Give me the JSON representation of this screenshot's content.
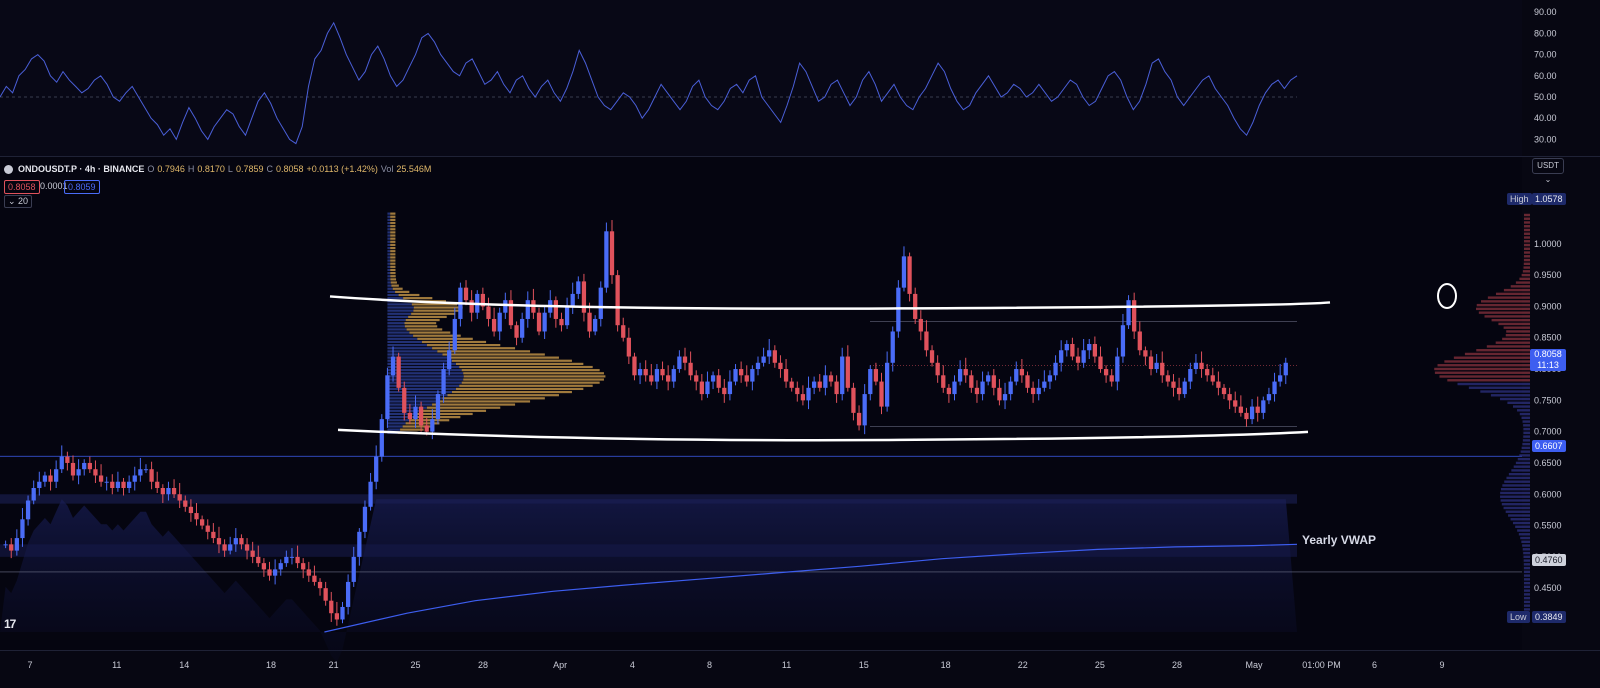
{
  "header": {
    "symbol": "ONDOUSDT.P · 4h · BINANCE",
    "o_label": "O",
    "o_value": "0.7946",
    "h_label": "H",
    "h_value": "0.8170",
    "l_label": "L",
    "l_value": "0.7859",
    "c_label": "C",
    "c_value": "0.8058",
    "change": "+0.0113 (+1.42%)",
    "vol_label": "Vol",
    "vol_value": "25.546M",
    "bid": "0.8058",
    "spread": "0.0001",
    "ask": "0.8059",
    "indicator": "20",
    "currency": "USDT"
  },
  "colors": {
    "background": "#070712",
    "bull": "#4a6cf7",
    "bear": "#e0525c",
    "profile_orange": "#d4a24c",
    "profile_blue": "#3a55c8",
    "rsi_line": "#4a5fd8",
    "vwap_line": "#3d5ef0"
  },
  "chart_data": [
    {
      "type": "line",
      "name": "RSI panel",
      "ylim": [
        25,
        92
      ],
      "y_ticks": [
        "90.00",
        "80.00",
        "70.00",
        "60.00",
        "50.00",
        "40.00",
        "30.00"
      ],
      "y_tick_values": [
        90,
        80,
        70,
        60,
        50,
        40,
        30
      ],
      "midline": 50,
      "series": [
        {
          "values": [
            50,
            55,
            52,
            60,
            63,
            68,
            70,
            67,
            60,
            57,
            62,
            58,
            55,
            52,
            54,
            58,
            60,
            56,
            50,
            48,
            52,
            55,
            50,
            45,
            40,
            37,
            32,
            35,
            30,
            38,
            45,
            40,
            34,
            30,
            36,
            40,
            44,
            42,
            36,
            32,
            40,
            48,
            52,
            47,
            40,
            35,
            30,
            28,
            36,
            55,
            68,
            72,
            80,
            85,
            78,
            70,
            64,
            58,
            62,
            70,
            74,
            68,
            60,
            55,
            58,
            64,
            70,
            78,
            80,
            76,
            70,
            66,
            62,
            60,
            66,
            68,
            62,
            56,
            58,
            62,
            56,
            52,
            58,
            60,
            54,
            50,
            55,
            58,
            52,
            48,
            54,
            62,
            72,
            66,
            58,
            50,
            46,
            44,
            48,
            52,
            50,
            46,
            40,
            44,
            50,
            56,
            52,
            48,
            44,
            48,
            55,
            58,
            50,
            46,
            44,
            48,
            54,
            56,
            52,
            58,
            60,
            50,
            46,
            42,
            38,
            46,
            55,
            66,
            62,
            55,
            48,
            50,
            56,
            58,
            52,
            46,
            50,
            58,
            62,
            56,
            48,
            52,
            56,
            50,
            46,
            44,
            50,
            54,
            60,
            66,
            62,
            54,
            48,
            44,
            46,
            52,
            56,
            60,
            55,
            50,
            52,
            56,
            54,
            50,
            52,
            56,
            52,
            48,
            50,
            54,
            58,
            56,
            50,
            46,
            48,
            54,
            60,
            62,
            58,
            50,
            44,
            48,
            56,
            66,
            68,
            62,
            58,
            50,
            46,
            50,
            54,
            58,
            60,
            54,
            50,
            46,
            40,
            35,
            32,
            38,
            46,
            52,
            56,
            58,
            54,
            58,
            60
          ]
        }
      ]
    },
    {
      "type": "candlestick",
      "name": "ONDOUSDT.P 4h",
      "ylim": [
        0.38,
        1.07
      ],
      "y_ticks": [
        "1.0000",
        "0.9500",
        "0.9000",
        "0.8500",
        "0.8000",
        "0.7500",
        "0.7000",
        "0.6500",
        "0.6000",
        "0.5500",
        "0.5000",
        "0.4500",
        "0.4000"
      ],
      "y_tick_values": [
        1.0,
        0.95,
        0.9,
        0.85,
        0.8,
        0.75,
        0.7,
        0.65,
        0.6,
        0.55,
        0.5,
        0.45,
        0.4
      ],
      "x_ticks": [
        "7",
        "11",
        "14",
        "18",
        "21",
        "25",
        "28",
        "Apr",
        "4",
        "8",
        "11",
        "15",
        "18",
        "22",
        "25",
        "28",
        "May",
        "01:00 PM",
        "6",
        "9"
      ],
      "x_tick_values": [
        0,
        18,
        32,
        50,
        63,
        80,
        94,
        110,
        125,
        141,
        157,
        173,
        190,
        206,
        222,
        238,
        254,
        268,
        279,
        293
      ],
      "price_labels": {
        "high_label": "High",
        "high_value": "1.0578",
        "current_value": "0.8058",
        "countdown": "11:13",
        "level_value": "0.6607",
        "level2_value": "0.4760",
        "low_label": "Low",
        "low_value": "0.3849"
      },
      "closes": [
        0.52,
        0.51,
        0.53,
        0.56,
        0.59,
        0.61,
        0.62,
        0.63,
        0.62,
        0.64,
        0.66,
        0.65,
        0.63,
        0.64,
        0.65,
        0.64,
        0.63,
        0.62,
        0.62,
        0.61,
        0.62,
        0.61,
        0.62,
        0.63,
        0.64,
        0.64,
        0.62,
        0.61,
        0.6,
        0.61,
        0.6,
        0.59,
        0.58,
        0.57,
        0.56,
        0.55,
        0.54,
        0.53,
        0.52,
        0.51,
        0.52,
        0.53,
        0.52,
        0.51,
        0.5,
        0.49,
        0.48,
        0.47,
        0.48,
        0.49,
        0.5,
        0.5,
        0.49,
        0.48,
        0.47,
        0.46,
        0.45,
        0.43,
        0.41,
        0.4,
        0.42,
        0.46,
        0.5,
        0.54,
        0.58,
        0.62,
        0.66,
        0.72,
        0.79,
        0.82,
        0.77,
        0.73,
        0.72,
        0.74,
        0.71,
        0.7,
        0.72,
        0.76,
        0.8,
        0.83,
        0.88,
        0.93,
        0.91,
        0.89,
        0.92,
        0.9,
        0.88,
        0.86,
        0.89,
        0.91,
        0.87,
        0.85,
        0.88,
        0.91,
        0.89,
        0.86,
        0.89,
        0.91,
        0.88,
        0.87,
        0.9,
        0.92,
        0.94,
        0.89,
        0.86,
        0.88,
        0.93,
        1.02,
        0.95,
        0.87,
        0.85,
        0.82,
        0.79,
        0.8,
        0.79,
        0.78,
        0.8,
        0.79,
        0.78,
        0.8,
        0.82,
        0.81,
        0.79,
        0.78,
        0.76,
        0.78,
        0.79,
        0.77,
        0.76,
        0.78,
        0.8,
        0.79,
        0.78,
        0.8,
        0.81,
        0.82,
        0.83,
        0.81,
        0.8,
        0.78,
        0.77,
        0.76,
        0.75,
        0.77,
        0.78,
        0.77,
        0.79,
        0.78,
        0.76,
        0.82,
        0.77,
        0.73,
        0.71,
        0.76,
        0.8,
        0.78,
        0.74,
        0.81,
        0.86,
        0.93,
        0.98,
        0.92,
        0.88,
        0.86,
        0.83,
        0.81,
        0.79,
        0.77,
        0.76,
        0.78,
        0.8,
        0.79,
        0.77,
        0.76,
        0.78,
        0.79,
        0.77,
        0.75,
        0.76,
        0.78,
        0.8,
        0.79,
        0.77,
        0.76,
        0.77,
        0.78,
        0.79,
        0.81,
        0.83,
        0.84,
        0.82,
        0.81,
        0.83,
        0.84,
        0.82,
        0.8,
        0.79,
        0.78,
        0.82,
        0.87,
        0.91,
        0.86,
        0.83,
        0.82,
        0.8,
        0.81,
        0.79,
        0.78,
        0.77,
        0.76,
        0.78,
        0.8,
        0.81,
        0.8,
        0.79,
        0.78,
        0.77,
        0.76,
        0.75,
        0.74,
        0.73,
        0.72,
        0.74,
        0.73,
        0.75,
        0.76,
        0.78,
        0.79,
        0.81
      ],
      "yearly_vwap": {
        "label": "Yearly VWAP",
        "x": [
          63,
          80,
          94,
          110,
          125,
          141,
          157,
          173,
          190,
          206,
          222,
          238,
          254,
          268
        ],
        "values": [
          0.38,
          0.41,
          0.43,
          0.445,
          0.455,
          0.465,
          0.475,
          0.485,
          0.497,
          0.505,
          0.512,
          0.516,
          0.518,
          0.52
        ]
      },
      "range_lines": {
        "top": 0.9,
        "bottom": 0.69
      },
      "volume_profile_note": "fixed range volume profile overlay (orange/blue)"
    }
  ]
}
